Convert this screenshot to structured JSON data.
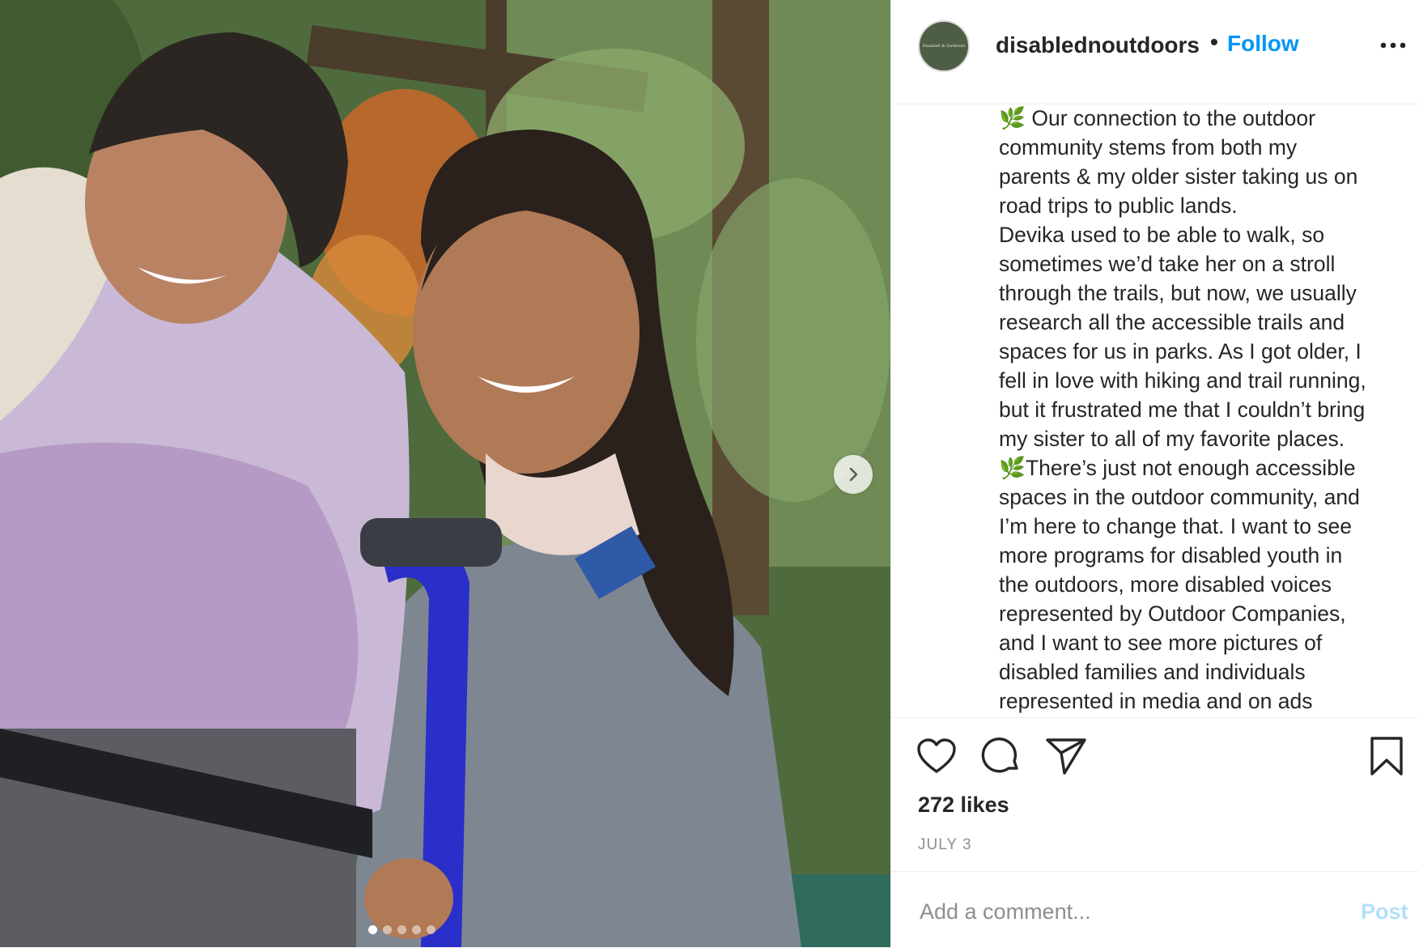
{
  "account": {
    "username": "disablednoutdoors",
    "separator": "•",
    "follow_label": "Follow",
    "avatar_lettering": "Disabled & Outdoors",
    "avatar_bg": "#4e5e45"
  },
  "caption_lines": [
    "🌿 Our connection to the outdoor",
    "community stems from both my",
    "parents & my older sister taking us on",
    "road trips to public lands.",
    "Devika used to be able to walk, so",
    "sometimes we’d take her on a stroll",
    "through the trails, but now, we usually",
    "research all the accessible trails and",
    "spaces for us in parks. As I got older, I",
    "fell in love with hiking and trail running,",
    "but it frustrated me that I couldn’t bring",
    "my sister to all of my favorite places.",
    "🌿There’s just not enough accessible",
    "spaces in the outdoor community, and",
    "I’m here to change that. I want to see",
    "more programs for disabled youth in",
    "the outdoors, more disabled voices",
    "represented by Outdoor Companies,",
    "and I want to see more pictures of",
    "disabled families and individuals",
    "represented in media and on ads"
  ],
  "stats": {
    "likes": "272 likes",
    "date": "JULY 3"
  },
  "comment": {
    "placeholder": "Add a comment...",
    "post_label": "Post"
  },
  "carousel": {
    "slide_count": 5,
    "current_index": 0
  },
  "icons": [
    "heart-icon",
    "comment-icon",
    "share-icon",
    "bookmark-icon",
    "more-icon",
    "chevron-right-icon"
  ],
  "colors": {
    "link_blue": "#0095f6",
    "post_disabled": "#b2dffc",
    "muted": "#8e8e8e",
    "text": "#262626"
  }
}
